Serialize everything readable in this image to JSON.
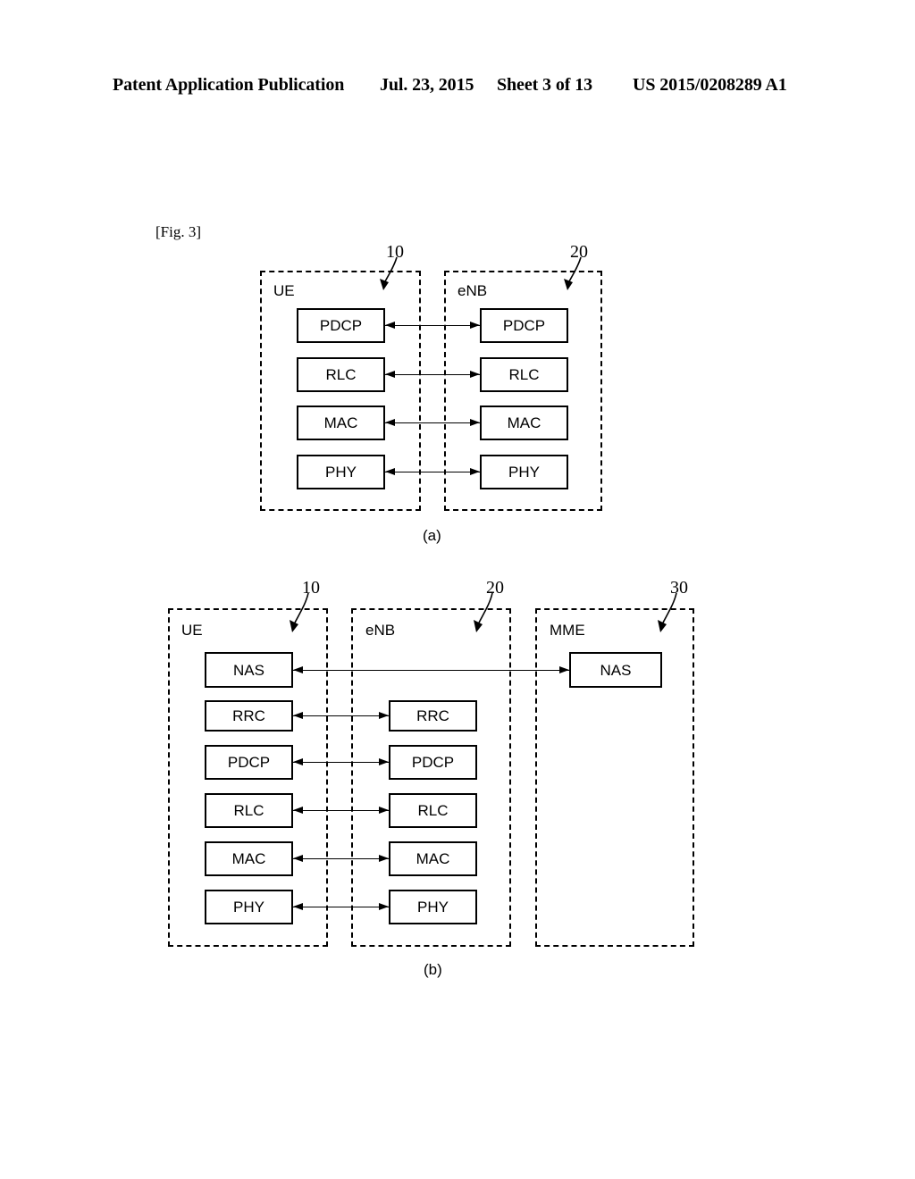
{
  "header": {
    "publication": "Patent Application Publication",
    "date": "Jul. 23, 2015",
    "sheet": "Sheet 3 of 13",
    "publication_number": "US 2015/0208289 A1"
  },
  "figure": {
    "label": "[Fig. 3]",
    "subfigures": [
      {
        "caption": "(a)",
        "panels": [
          {
            "name": "UE",
            "ref": "10",
            "layers": [
              "PDCP",
              "RLC",
              "MAC",
              "PHY"
            ]
          },
          {
            "name": "eNB",
            "ref": "20",
            "layers": [
              "PDCP",
              "RLC",
              "MAC",
              "PHY"
            ]
          }
        ],
        "connections": [
          "PDCP",
          "RLC",
          "MAC",
          "PHY"
        ]
      },
      {
        "caption": "(b)",
        "panels": [
          {
            "name": "UE",
            "ref": "10",
            "layers": [
              "NAS",
              "RRC",
              "PDCP",
              "RLC",
              "MAC",
              "PHY"
            ]
          },
          {
            "name": "eNB",
            "ref": "20",
            "layers": [
              "RRC",
              "PDCP",
              "RLC",
              "MAC",
              "PHY"
            ]
          },
          {
            "name": "MME",
            "ref": "30",
            "layers": [
              "NAS"
            ]
          }
        ],
        "connections": [
          "NAS",
          "RRC",
          "PDCP",
          "RLC",
          "MAC",
          "PHY"
        ]
      }
    ]
  },
  "colors": {
    "ink": "#000000",
    "paper": "#ffffff"
  }
}
